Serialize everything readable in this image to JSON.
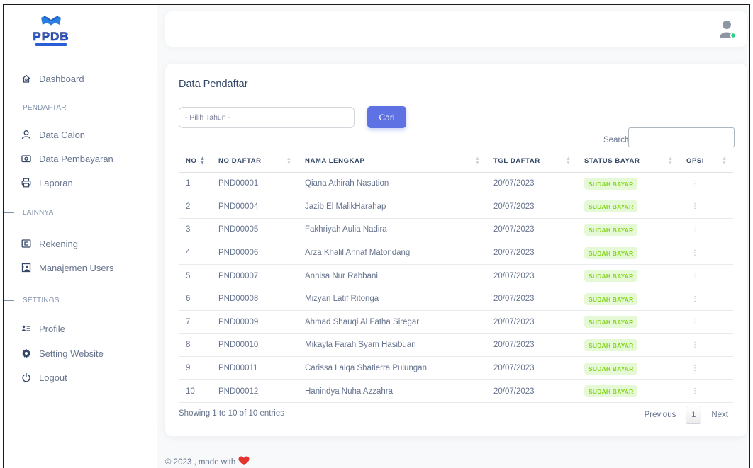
{
  "app": {
    "logo_text": "PPDB"
  },
  "sidebar": {
    "dashboard": "Dashboard",
    "section_pendaftar": "PENDAFTAR",
    "data_calon": "Data Calon",
    "data_pembayaran": "Data Pembayaran",
    "laporan": "Laporan",
    "section_lainnya": "LAINNYA",
    "rekening": "Rekening",
    "manajemen_users": "Manajemen Users",
    "section_settings": "SETTINGS",
    "profile": "Profile",
    "setting_website": "Setting Website",
    "logout": "Logout"
  },
  "page": {
    "title": "Data Pendaftar",
    "year_select_value": "- Pilih Tahun -",
    "search_button": "Cari",
    "search_label": "Search:",
    "search_value": ""
  },
  "table": {
    "headers": [
      "NO",
      "NO DAFTAR",
      "NAMA LENGKAP",
      "TGL DAFTAR",
      "STATUS BAYAR",
      "OPSI"
    ],
    "rows": [
      {
        "no": "1",
        "no_daftar": "PND00001",
        "nama": "Qiana Athirah Nasution",
        "tgl": "20/07/2023",
        "status": "SUDAH BAYAR",
        "opsi": "⋮"
      },
      {
        "no": "2",
        "no_daftar": "PND00004",
        "nama": "Jazib El MalikHarahap",
        "tgl": "20/07/2023",
        "status": "SUDAH BAYAR",
        "opsi": "⋮"
      },
      {
        "no": "3",
        "no_daftar": "PND00005",
        "nama": "Fakhriyah Aulia Nadira",
        "tgl": "20/07/2023",
        "status": "SUDAH BAYAR",
        "opsi": "⋮"
      },
      {
        "no": "4",
        "no_daftar": "PND00006",
        "nama": "Arza Khalil Ahnaf Matondang",
        "tgl": "20/07/2023",
        "status": "SUDAH BAYAR",
        "opsi": "⋮"
      },
      {
        "no": "5",
        "no_daftar": "PND00007",
        "nama": "Annisa Nur Rabbani",
        "tgl": "20/07/2023",
        "status": "SUDAH BAYAR",
        "opsi": "⋮"
      },
      {
        "no": "6",
        "no_daftar": "PND00008",
        "nama": "Mizyan Latif Ritonga",
        "tgl": "20/07/2023",
        "status": "SUDAH BAYAR",
        "opsi": "⋮"
      },
      {
        "no": "7",
        "no_daftar": "PND00009",
        "nama": "Ahmad Shauqi Al Fatha Siregar",
        "tgl": "20/07/2023",
        "status": "SUDAH BAYAR",
        "opsi": "⋮"
      },
      {
        "no": "8",
        "no_daftar": "PND00010",
        "nama": "Mikayla Farah Syam Hasibuan",
        "tgl": "20/07/2023",
        "status": "SUDAH BAYAR",
        "opsi": "⋮"
      },
      {
        "no": "9",
        "no_daftar": "PND00011",
        "nama": "Carissa Laiqa Shatierra Pulungan",
        "tgl": "20/07/2023",
        "status": "SUDAH BAYAR",
        "opsi": "⋮"
      },
      {
        "no": "10",
        "no_daftar": "PND00012",
        "nama": "Hanindya Nuha Azzahra",
        "tgl": "20/07/2023",
        "status": "SUDAH BAYAR",
        "opsi": "⋮"
      }
    ]
  },
  "pagination": {
    "info": "Showing 1 to 10 of 10 entries",
    "previous": "Previous",
    "current": "1",
    "next": "Next"
  },
  "footer": {
    "text": "© 2023 , made with"
  },
  "icons": {
    "dashboard": "home-icon",
    "data_calon": "user-icon",
    "data_pembayaran": "money-icon",
    "laporan": "printer-icon",
    "rekening": "card-icon",
    "manajemen_users": "users-icon",
    "profile": "profile-list-icon",
    "setting_website": "gear-icon",
    "logout": "power-icon",
    "footer": "heart-icon"
  },
  "colors": {
    "primary": "#5e72e4",
    "badge_bg": "#e6f9d6",
    "badge_text": "#82d616",
    "heart": "#e3342f",
    "online_dot": "#2dce89"
  }
}
